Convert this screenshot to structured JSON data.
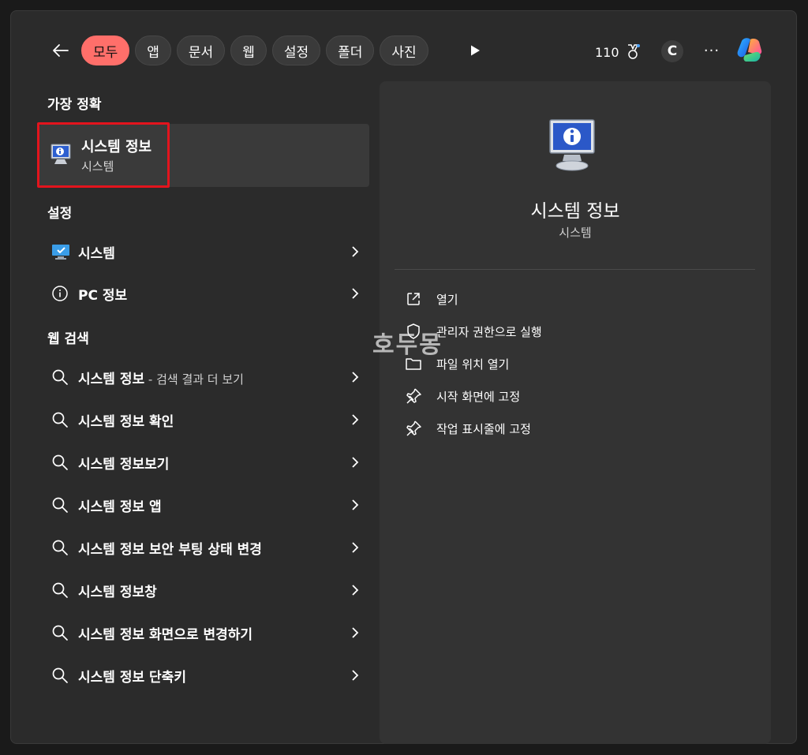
{
  "tabs": [
    {
      "label": "모두",
      "active": true
    },
    {
      "label": "앱",
      "active": false
    },
    {
      "label": "문서",
      "active": false
    },
    {
      "label": "웹",
      "active": false
    },
    {
      "label": "설정",
      "active": false
    },
    {
      "label": "폴더",
      "active": false
    },
    {
      "label": "사진",
      "active": false
    }
  ],
  "header": {
    "points": "110",
    "avatar_letter": "C",
    "more": "···"
  },
  "best_match": {
    "section_title": "가장 정확",
    "title": "시스템 정보",
    "subtitle": "시스템"
  },
  "settings": {
    "section_title": "설정",
    "items": [
      {
        "label": "시스템",
        "icon": "monitor-check-icon"
      },
      {
        "label": "PC 정보",
        "icon": "info-icon"
      }
    ]
  },
  "web": {
    "section_title": "웹 검색",
    "first": {
      "label": "시스템 정보",
      "suffix": " - 검색 결과 더 보기"
    },
    "items": [
      "시스템 정보 확인",
      "시스템 정보보기",
      "시스템 정보 앱",
      "시스템 정보 보안 부팅 상태 변경",
      "시스템 정보창",
      "시스템 정보 화면으로 변경하기",
      "시스템 정보 단축키"
    ]
  },
  "details": {
    "name": "시스템 정보",
    "category": "시스템",
    "actions": [
      {
        "label": "열기",
        "icon": "open-external-icon"
      },
      {
        "label": "관리자 권한으로 실행",
        "icon": "shield-admin-icon"
      },
      {
        "label": "파일 위치 열기",
        "icon": "folder-icon"
      },
      {
        "label": "시작 화면에 고정",
        "icon": "pin-icon"
      },
      {
        "label": "작업 표시줄에 고정",
        "icon": "pin-icon"
      }
    ]
  },
  "watermark": "호두몽",
  "colors": {
    "accent": "#ff6f6a",
    "highlight_box": "#e3141d",
    "panel": "#333333",
    "background": "#2b2b2b"
  }
}
